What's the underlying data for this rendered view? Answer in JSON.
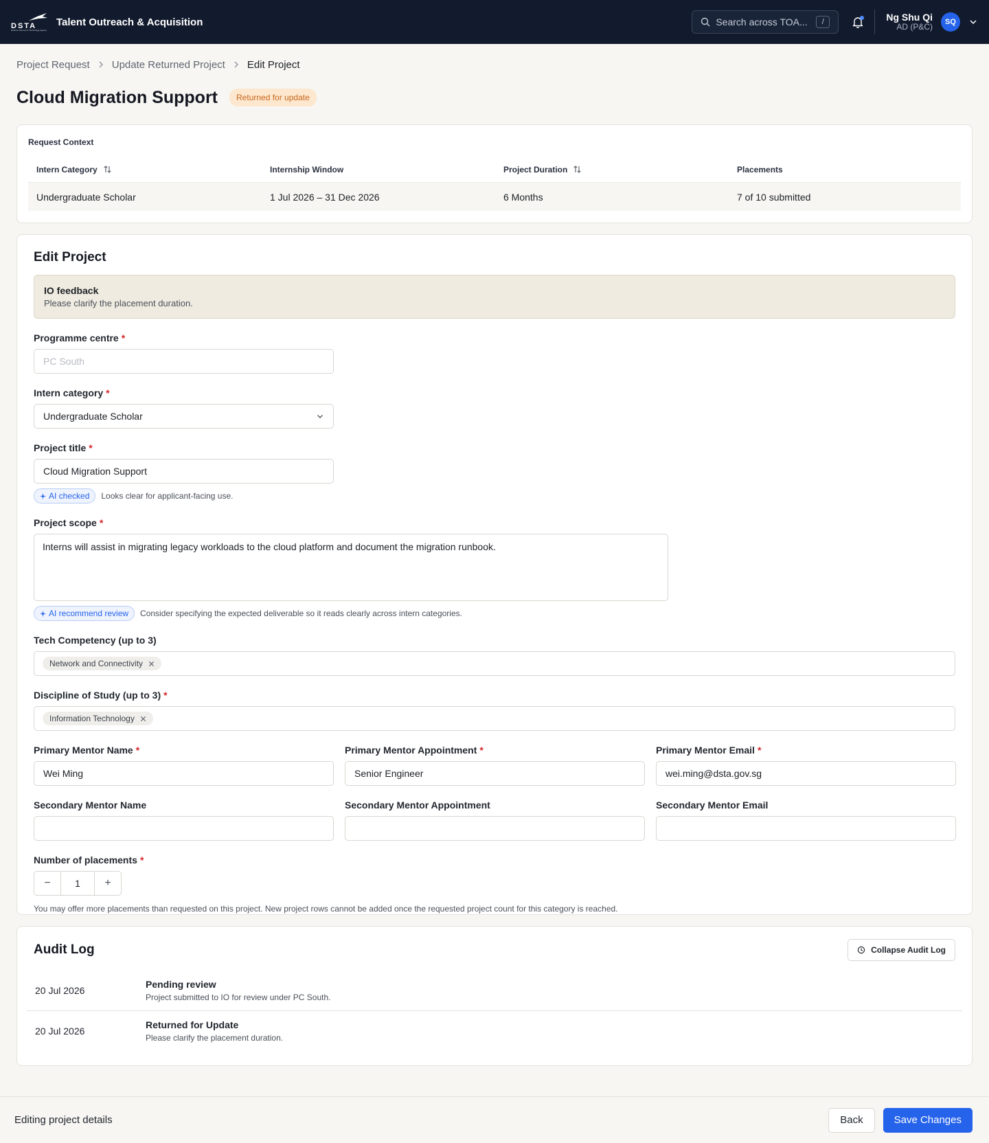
{
  "header": {
    "logo_text": "DSTA",
    "logo_subtext": "Defence Science & Technology Agency",
    "app_title": "Talent Outreach & Acquisition",
    "search_placeholder": "Search across TOA...",
    "search_shortcut": "/",
    "user_name": "Ng Shu Qi",
    "user_role": "AD (P&C)",
    "user_initials": "SQ"
  },
  "breadcrumb": [
    "Project Request",
    "Update Returned Project",
    "Edit Project"
  ],
  "page": {
    "title": "Cloud Migration Support",
    "status": "Returned for update"
  },
  "request_context": {
    "kicker": "Request Context",
    "columns": [
      "Intern Category",
      "Internship Window",
      "Project Duration",
      "Placements"
    ],
    "row": [
      "Undergraduate Scholar",
      "1 Jul 2026 – 31 Dec 2026",
      "6 Months",
      "7 of 10 submitted"
    ]
  },
  "edit": {
    "title": "Edit Project",
    "feedback_title": "IO feedback",
    "feedback_text": "Please clarify the placement duration.",
    "programme_centre": {
      "label": "Programme centre",
      "value": "PC South"
    },
    "intern_category": {
      "label": "Intern category",
      "value": "Undergraduate Scholar"
    },
    "project_title": {
      "label": "Project title",
      "value": "Cloud Migration Support",
      "ai_chip": "AI checked",
      "ai_note": "Looks clear for applicant-facing use."
    },
    "project_scope": {
      "label": "Project scope",
      "value": "Interns will assist in migrating legacy workloads to the cloud platform and document the migration runbook.",
      "ai_chip": "AI recommend review",
      "ai_note": "Consider specifying the expected deliverable so it reads clearly across intern categories."
    },
    "tech_competency": {
      "label": "Tech Competency (up to 3)",
      "tags": [
        "Network and Connectivity"
      ]
    },
    "discipline": {
      "label": "Discipline of Study (up to 3)",
      "tags": [
        "Information Technology"
      ]
    },
    "primary_mentor_name": {
      "label": "Primary Mentor Name",
      "value": "Wei Ming"
    },
    "primary_mentor_appointment": {
      "label": "Primary Mentor Appointment",
      "value": "Senior Engineer"
    },
    "primary_mentor_email": {
      "label": "Primary Mentor Email",
      "value": "wei.ming@dsta.gov.sg"
    },
    "secondary_mentor_name": {
      "label": "Secondary Mentor Name",
      "value": ""
    },
    "secondary_mentor_appointment": {
      "label": "Secondary Mentor Appointment",
      "value": ""
    },
    "secondary_mentor_email": {
      "label": "Secondary Mentor Email",
      "value": ""
    },
    "placements": {
      "label": "Number of placements",
      "value": "1",
      "minus": "−",
      "plus": "+",
      "help": "You may offer more placements than requested on this project. New project rows cannot be added once the requested project count for this category is reached."
    },
    "required_mark": "*"
  },
  "audit": {
    "title": "Audit Log",
    "collapse_label": "Collapse Audit Log",
    "entries": [
      {
        "date": "20 Jul 2026",
        "title": "Pending review",
        "text": "Project submitted to IO for review under PC South."
      },
      {
        "date": "20 Jul 2026",
        "title": "Returned for Update",
        "text": "Please clarify the placement duration."
      }
    ]
  },
  "footer": {
    "status_text": "Editing project details",
    "back_label": "Back",
    "save_label": "Save Changes"
  },
  "colors": {
    "topbar": "#121b2e",
    "primary": "#2563eb",
    "status_badge_bg": "#fde7cf",
    "status_badge_text": "#c7661a",
    "required": "#d3262c"
  }
}
